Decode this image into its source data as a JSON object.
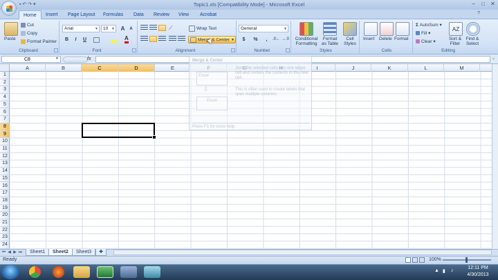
{
  "window": {
    "title": "Topic1.xls [Compatibility Mode] - Microsoft Excel",
    "controls": [
      "–",
      "□",
      "✕"
    ]
  },
  "ribbon": {
    "tabs": [
      "Home",
      "Insert",
      "Page Layout",
      "Formulas",
      "Data",
      "Review",
      "View",
      "Acrobat"
    ],
    "active_tab": "Home",
    "clipboard": {
      "paste": "Paste",
      "cut": "Cut",
      "copy": "Copy",
      "format_painter": "Format Painter",
      "label": "Clipboard"
    },
    "font": {
      "name": "Arial",
      "size": "10",
      "label": "Font",
      "bold": "B",
      "italic": "I",
      "underline": "U",
      "grow": "A",
      "shrink": "A"
    },
    "alignment": {
      "wrap_text": "Wrap Text",
      "merge_center": "Merge & Center",
      "label": "Alignment"
    },
    "number": {
      "format": "General",
      "currency": "$",
      "percent": "%",
      "comma": ",",
      "label": "Number"
    },
    "styles": {
      "conditional": [
        "Conditional",
        "Formatting"
      ],
      "format_table": [
        "Format",
        "as Table"
      ],
      "cell_styles": [
        "Cell",
        "Styles"
      ],
      "label": "Styles"
    },
    "cells": {
      "insert": "Insert",
      "delete": "Delete",
      "format": "Format",
      "label": "Cells"
    },
    "editing": {
      "autosum": "AutoSum",
      "fill": "Fill",
      "clear": "Clear",
      "sort_filter": [
        "Sort &",
        "Filter"
      ],
      "find_select": [
        "Find &",
        "Select"
      ],
      "label": "Editing"
    }
  },
  "formula_bar": {
    "name_box": "C8",
    "fx": "fx",
    "content": ""
  },
  "tooltip": {
    "title": "Merge & Center",
    "line1": "Joins the selected cells into one larger cell and centers the contents in the new cell.",
    "line2": "This is often used to create labels that span multiple columns.",
    "box1": "Excel",
    "box2": "Excel",
    "help": "Press F1 for more help."
  },
  "grid": {
    "columns": [
      "A",
      "B",
      "C",
      "D",
      "E",
      "F",
      "G",
      "H",
      "I",
      "J",
      "K",
      "L",
      "M"
    ],
    "rows": [
      "1",
      "2",
      "3",
      "4",
      "5",
      "6",
      "7",
      "8",
      "9",
      "10",
      "11",
      "12",
      "13",
      "14",
      "15",
      "16",
      "17",
      "18",
      "19",
      "20",
      "21",
      "22",
      "23",
      "24"
    ],
    "selected_cell": "C8"
  },
  "sheets": {
    "tabs": [
      "Sheet1",
      "Sheet2",
      "Sheet3"
    ],
    "active": "Sheet2"
  },
  "status": {
    "ready": "Ready",
    "zoom": "100%"
  },
  "taskbar": {
    "time": "12:11 PM",
    "date": "4/30/2013"
  },
  "colors": {
    "accent": "#f8c86a",
    "ribbon": "#d3e2f5",
    "taskbar": "#233a55"
  }
}
